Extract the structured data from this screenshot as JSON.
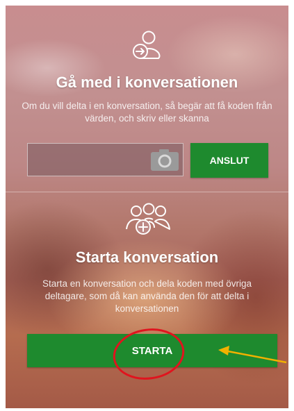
{
  "join": {
    "title": "Gå med i konversationen",
    "description": "Om du vill delta i en konversation, så begär att få koden från värden, och skriv eller skanna",
    "code_value": "",
    "button_label": "ANSLUT"
  },
  "start": {
    "title": "Starta konversation",
    "description": "Starta en konversation och dela koden med övriga deltagare, som då kan använda den för att delta i konversationen",
    "button_label": "STARTA"
  },
  "icons": {
    "join": "person-arrow-icon",
    "camera": "camera-icon",
    "start": "group-add-icon"
  },
  "colors": {
    "button_green": "#1e8a2e",
    "annotation_circle": "#e0141e",
    "annotation_arrow": "#f2b100"
  }
}
